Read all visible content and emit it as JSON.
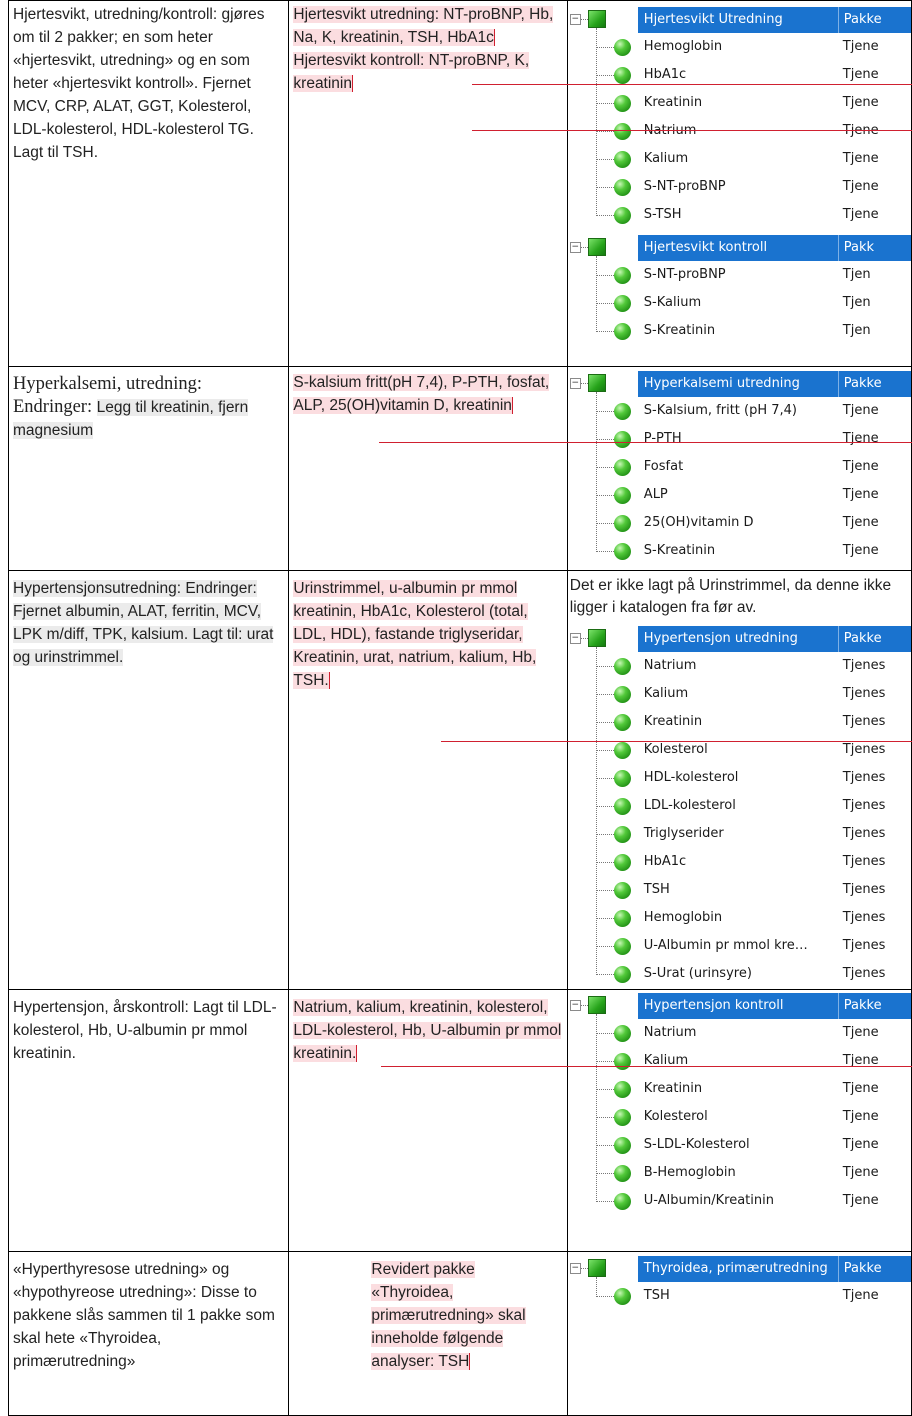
{
  "rows": [
    {
      "col1": "Hjertesvikt, utredning/kontroll: gjøres om til 2 pakker; en som heter «hjertesvikt, utredning» og en som heter «hjertesvikt kontroll». Fjernet MCV, CRP, ALAT, GGT, Kolesterol, LDL-kolesterol, HDL-kolesterol TG. Lagt til TSH.",
      "col2a": "Hjertesvikt utredning: NT-proBNP, Hb, Na, K, kreatinin, TSH, HbA1c",
      "col2b": "Hjertesvikt kontroll: NT-proBNP, K, kreatinin",
      "trees": [
        {
          "header": "Hjertesvikt Utredning",
          "header2": "Pakke",
          "items": [
            {
              "label": "Hemoglobin",
              "label2": "Tjene"
            },
            {
              "label": "HbA1c",
              "label2": "Tjene"
            },
            {
              "label": "Kreatinin",
              "label2": "Tjene"
            },
            {
              "label": "Natrium",
              "label2": "Tjene"
            },
            {
              "label": "Kalium",
              "label2": "Tjene"
            },
            {
              "label": "S-NT-proBNP",
              "label2": "Tjene"
            },
            {
              "label": "S-TSH",
              "label2": "Tjene"
            }
          ]
        },
        {
          "header": "Hjertesvikt kontroll",
          "header2": "Pakk",
          "items": [
            {
              "label": "S-NT-proBNP",
              "label2": "Tjen"
            },
            {
              "label": "S-Kalium",
              "label2": "Tjen"
            },
            {
              "label": "S-Kreatinin",
              "label2": "Tjen"
            }
          ]
        }
      ]
    },
    {
      "col1_serif": "Hyperkalsemi, utredning: Endringer:",
      "col1_hl": "Legg til kreatinin, fjern magnesium",
      "col2a": "S-kalsium fritt(pH 7,4), P-PTH, fosfat, ALP, 25(OH)vitamin D, kreatinin",
      "trees": [
        {
          "header": "Hyperkalsemi utredning",
          "header2": "Pakke",
          "items": [
            {
              "label": "S-Kalsium, fritt (pH 7,4)",
              "label2": "Tjene"
            },
            {
              "label": "P-PTH",
              "label2": "Tjene"
            },
            {
              "label": "Fosfat",
              "label2": "Tjene"
            },
            {
              "label": "ALP",
              "label2": "Tjene"
            },
            {
              "label": "25(OH)vitamin D",
              "label2": "Tjene"
            },
            {
              "label": "S-Kreatinin",
              "label2": "Tjene"
            }
          ]
        }
      ]
    },
    {
      "col1": "Hypertensjonsutredning: Endringer: Fjernet albumin, ALAT, ferritin, MCV, LPK m/diff, TPK, kalsium. Lagt til: urat og urinstrimmel.",
      "col2a": "Urinstrimmel, u-albumin pr mmol kreatinin, HbA1c, Kolesterol (total, LDL, HDL), fastande triglyseridar, Kreatinin, urat, natrium, kalium, Hb, TSH.",
      "note": "Det er ikke lagt på Urinstrimmel, da denne ikke ligger i katalogen fra før av.",
      "trees": [
        {
          "header": "Hypertensjon utredning",
          "header2": "Pakke",
          "items": [
            {
              "label": "Natrium",
              "label2": "Tjenes"
            },
            {
              "label": "Kalium",
              "label2": "Tjenes"
            },
            {
              "label": "Kreatinin",
              "label2": "Tjenes"
            },
            {
              "label": "Kolesterol",
              "label2": "Tjenes"
            },
            {
              "label": "HDL-kolesterol",
              "label2": "Tjenes"
            },
            {
              "label": "LDL-kolesterol",
              "label2": "Tjenes"
            },
            {
              "label": "Triglyserider",
              "label2": "Tjenes"
            },
            {
              "label": "HbA1c",
              "label2": "Tjenes"
            },
            {
              "label": "TSH",
              "label2": "Tjenes"
            },
            {
              "label": "Hemoglobin",
              "label2": "Tjenes"
            },
            {
              "label": "U-Albumin pr mmol kre…",
              "label2": "Tjenes"
            },
            {
              "label": "S-Urat (urinsyre)",
              "label2": "Tjenes"
            }
          ]
        }
      ]
    },
    {
      "col1": "Hypertensjon, årskontroll: Lagt til LDL-kolesterol, Hb, U-albumin pr mmol kreatinin.",
      "col2a": "Natrium, kalium, kreatinin, kolesterol, LDL-kolesterol, Hb, U-albumin pr mmol kreatinin.",
      "trees": [
        {
          "header": "Hypertensjon kontroll",
          "header2": "Pakke",
          "items": [
            {
              "label": "Natrium",
              "label2": "Tjene"
            },
            {
              "label": "Kalium",
              "label2": "Tjene"
            },
            {
              "label": "Kreatinin",
              "label2": "Tjene"
            },
            {
              "label": "Kolesterol",
              "label2": "Tjene"
            },
            {
              "label": "S-LDL-Kolesterol",
              "label2": "Tjene"
            },
            {
              "label": "B-Hemoglobin",
              "label2": "Tjene"
            },
            {
              "label": "U-Albumin/Kreatinin",
              "label2": "Tjene"
            }
          ]
        }
      ]
    },
    {
      "col1": "«Hyperthyresose utredning» og «hypothyreose utredning»: Disse to pakkene slås sammen til 1 pakke som skal hete «Thyroidea, primærutredning»",
      "col2a": "Revidert pakke «Thyroidea, primærutredning» skal inneholde følgende analyser: TSH",
      "trees": [
        {
          "header": "Thyroidea, primærutredning",
          "header2": "Pakke",
          "items": [
            {
              "label": "TSH",
              "label2": "Tjene"
            }
          ]
        }
      ]
    }
  ]
}
